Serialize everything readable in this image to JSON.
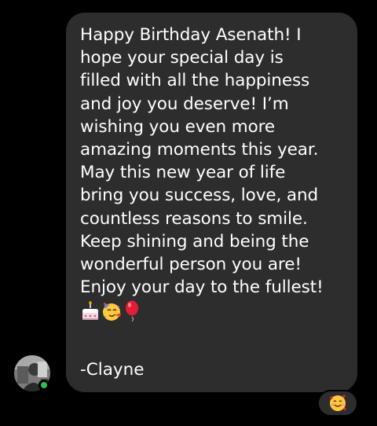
{
  "message": {
    "lines": [
      "Happy Birthday Asenath! I",
      "hope your special day is",
      "filled with all the happiness",
      "and joy you deserve! I’m",
      "wishing you even more",
      "amazing moments this year.",
      "May this new year of life",
      "bring you success, love, and",
      "countless reasons to smile.",
      "Keep shining and being the",
      "wonderful person you are!",
      "Enjoy your day to the fullest!"
    ],
    "emojis": [
      "birthday-cake-icon",
      "partying-face-icon",
      "balloon-icon"
    ],
    "signature": "-Clayne"
  },
  "sender": {
    "avatar": "avatar-photo",
    "status": "online"
  },
  "reaction": {
    "emoji": "smiling-face-with-hearts-icon"
  },
  "colors": {
    "background": "#000000",
    "bubble": "#2d2d2d",
    "text": "#ffffff",
    "online": "#31c24d"
  }
}
